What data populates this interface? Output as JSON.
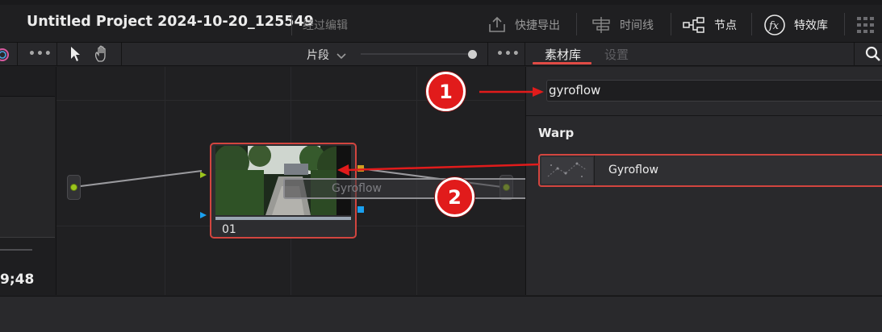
{
  "header": {
    "project_title": "Untitled Project 2024-10-20_125549",
    "status_text": "经过编辑",
    "quick_export_label": "快捷导出",
    "timeline_label": "时间线",
    "nodes_label": "节点",
    "effects_label": "特效库"
  },
  "toolbar": {
    "more_label": "•••",
    "clip_mode_label": "片段",
    "more_label_right": "•••",
    "tabs": [
      {
        "label": "素材库",
        "active": true
      },
      {
        "label": "设置",
        "active": false
      }
    ]
  },
  "viewer": {
    "timecode": "9;48"
  },
  "node_graph": {
    "node_label": "01",
    "drag_preview_label": "Gyroflow"
  },
  "library": {
    "search_value": "gyroflow",
    "category": "Warp",
    "items": [
      {
        "label": "Gyroflow"
      }
    ]
  },
  "annotations": {
    "step1": "1",
    "step2": "2",
    "color": "#e11b1b"
  },
  "colors": {
    "accent": "#d2453f",
    "input_port": "#9cc51c",
    "output_port": "#1aa0f0"
  }
}
